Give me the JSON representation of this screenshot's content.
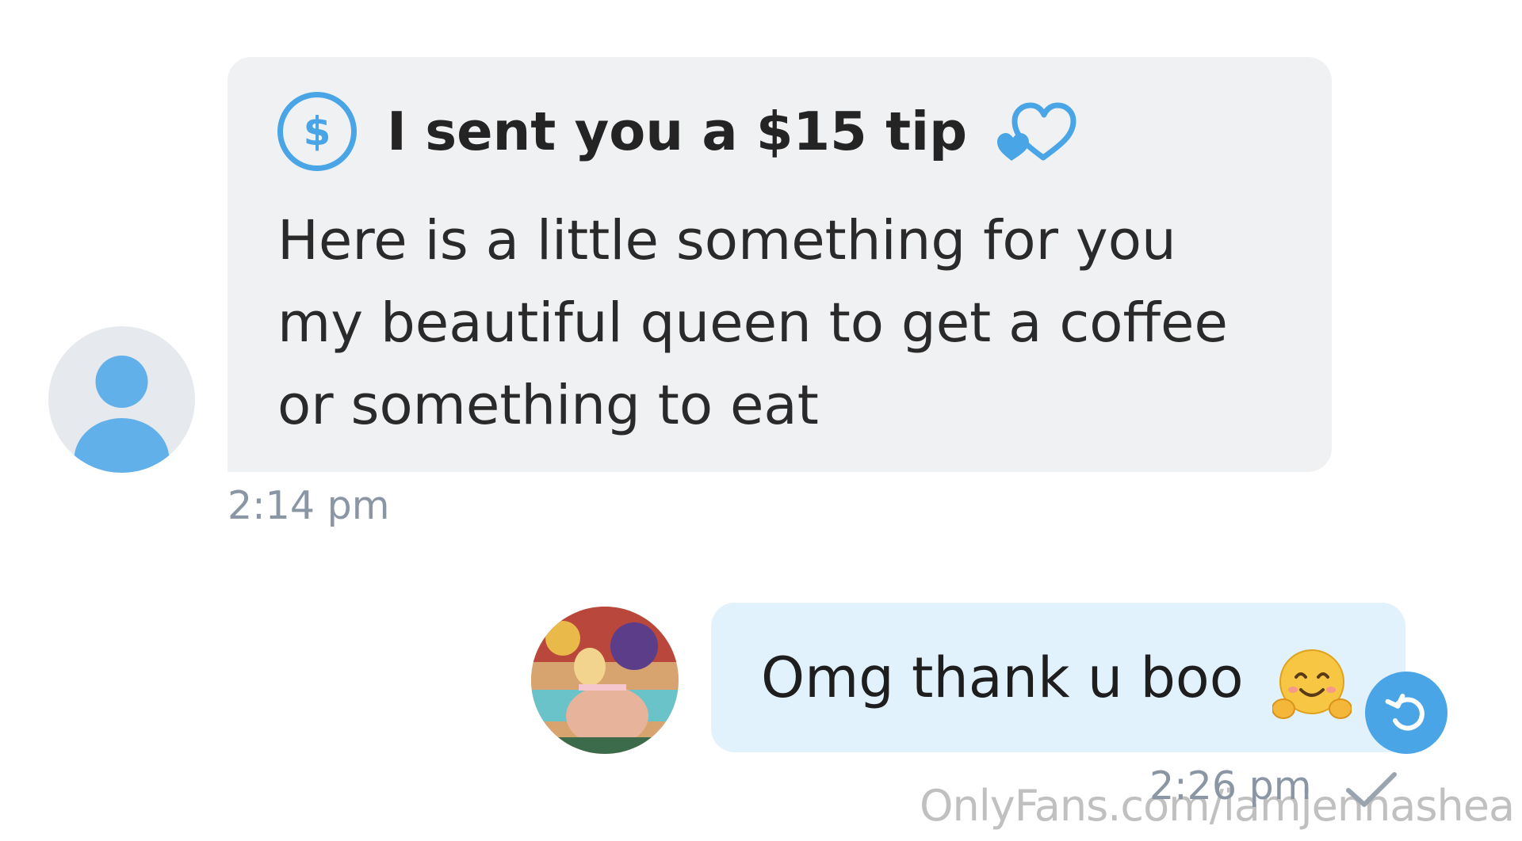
{
  "incoming": {
    "tip_currency_symbol": "$",
    "tip_title": "I sent you a $15 tip",
    "tip_icon": "dollar-circle-icon",
    "decoration_icon": "hearts-icon",
    "body": "Here is a little something for you my beautiful queen to get a coffee or something to eat",
    "time": "2:14 pm",
    "avatar": "default-user-avatar"
  },
  "outgoing": {
    "text": "Omg thank u boo",
    "emoji": "hugging-face-emoji",
    "time": "2:26 pm",
    "status_icon": "check-icon",
    "action_icon": "undo-icon",
    "avatar": "sender-photo-avatar"
  },
  "watermark": "OnlyFans.com/iamjennashea",
  "colors": {
    "accent": "#4aa5e6",
    "bubble_incoming": "#f0f1f3",
    "bubble_outgoing": "#e2f2fd",
    "timestamp": "#8a96a3"
  }
}
